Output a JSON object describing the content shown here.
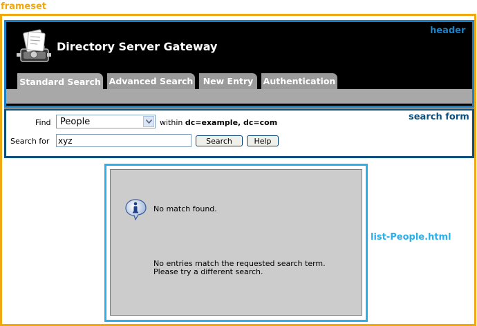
{
  "annotations": {
    "frameset": "frameset",
    "header": "header",
    "search_form": "search form",
    "list": "list-People.html"
  },
  "header": {
    "title": "Directory Server Gateway",
    "logo_icon": "rolodex-icon",
    "tabs": [
      {
        "label": "Standard Search",
        "active": true
      },
      {
        "label": "Advanced Search",
        "active": false
      },
      {
        "label": "New Entry",
        "active": false
      },
      {
        "label": "Authentication",
        "active": false
      }
    ]
  },
  "search_form": {
    "find_label": "Find",
    "find_value": "People",
    "within_label": "within",
    "base_dn": "dc=example, dc=com",
    "search_for_label": "Search for",
    "search_value": "xyz",
    "search_button": "Search",
    "help_button": "Help"
  },
  "results": {
    "icon": "info-icon",
    "status": "No match found.",
    "detail_line1": "No entries match the requested search term.",
    "detail_line2": "Please try a different search."
  },
  "colors": {
    "frameset": "#f0a810",
    "header": "#1a82c4",
    "search_form": "#0d4f7c",
    "list": "#29b0ec"
  }
}
